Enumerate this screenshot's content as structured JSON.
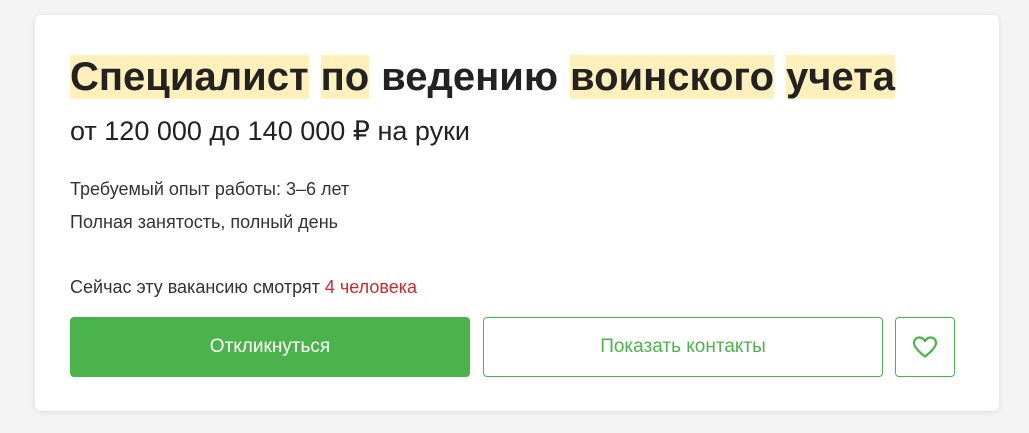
{
  "vacancy": {
    "title_words": [
      {
        "text": "Специалист",
        "highlighted": true
      },
      {
        "text": "по",
        "highlighted": true
      },
      {
        "text": "ведению",
        "highlighted": false
      },
      {
        "text": "воинского",
        "highlighted": true
      },
      {
        "text": "учета",
        "highlighted": true
      }
    ],
    "salary": "от 120 000 до 140 000 ₽ на руки",
    "experience": "Требуемый опыт работы: 3–6 лет",
    "employment": "Полная занятость, полный день",
    "watching_prefix": "Сейчас эту вакансию смотрят ",
    "watching_count": "4 человека"
  },
  "actions": {
    "respond_label": "Откликнуться",
    "contacts_label": "Показать контакты",
    "favorite_icon": "heart-icon"
  },
  "colors": {
    "accent": "#4bb34b",
    "highlight": "#fff0bc",
    "count": "#d0282c"
  }
}
